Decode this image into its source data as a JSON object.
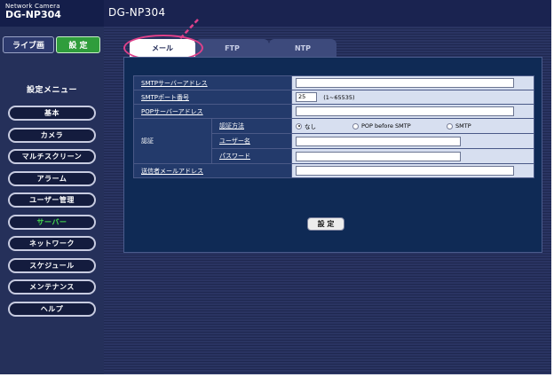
{
  "header": {
    "brand_small": "Network Camera",
    "brand_model": "DG-NP304",
    "page_model": "DG-NP304"
  },
  "sidebar": {
    "live_label": "ライブ画",
    "setup_label": "設 定",
    "menu_title": "設定メニュー",
    "items": [
      {
        "label": "基本",
        "active": false
      },
      {
        "label": "カメラ",
        "active": false
      },
      {
        "label": "マルチスクリーン",
        "active": false
      },
      {
        "label": "アラーム",
        "active": false
      },
      {
        "label": "ユーザー管理",
        "active": false
      },
      {
        "label": "サーバー",
        "active": true
      },
      {
        "label": "ネットワーク",
        "active": false
      },
      {
        "label": "スケジュール",
        "active": false
      },
      {
        "label": "メンテナンス",
        "active": false
      }
    ],
    "help_label": "ヘルプ"
  },
  "tabs": [
    {
      "label": "メール",
      "active": true
    },
    {
      "label": "FTP",
      "active": false
    },
    {
      "label": "NTP",
      "active": false
    }
  ],
  "form": {
    "smtp_address_label": "SMTPサーバーアドレス",
    "smtp_address_value": "",
    "smtp_port_label": "SMTPポート番号",
    "smtp_port_value": "25",
    "smtp_port_range": "(1~65535)",
    "pop_address_label": "POPサーバーアドレス",
    "pop_address_value": "",
    "auth_group_label": "認証",
    "auth_method_label": "認証方法",
    "auth_options": [
      {
        "label": "なし",
        "selected": true
      },
      {
        "label": "POP before SMTP",
        "selected": false
      },
      {
        "label": "SMTP",
        "selected": false
      }
    ],
    "username_label": "ユーザー名",
    "username_value": "",
    "password_label": "パスワード",
    "password_value": "",
    "sender_label": "送信者メールアドレス",
    "sender_value": "",
    "submit_label": "設 定"
  },
  "colors": {
    "highlight": "#e0418a",
    "active_menu": "#47e04f",
    "setup_button": "#2f9d3c"
  }
}
